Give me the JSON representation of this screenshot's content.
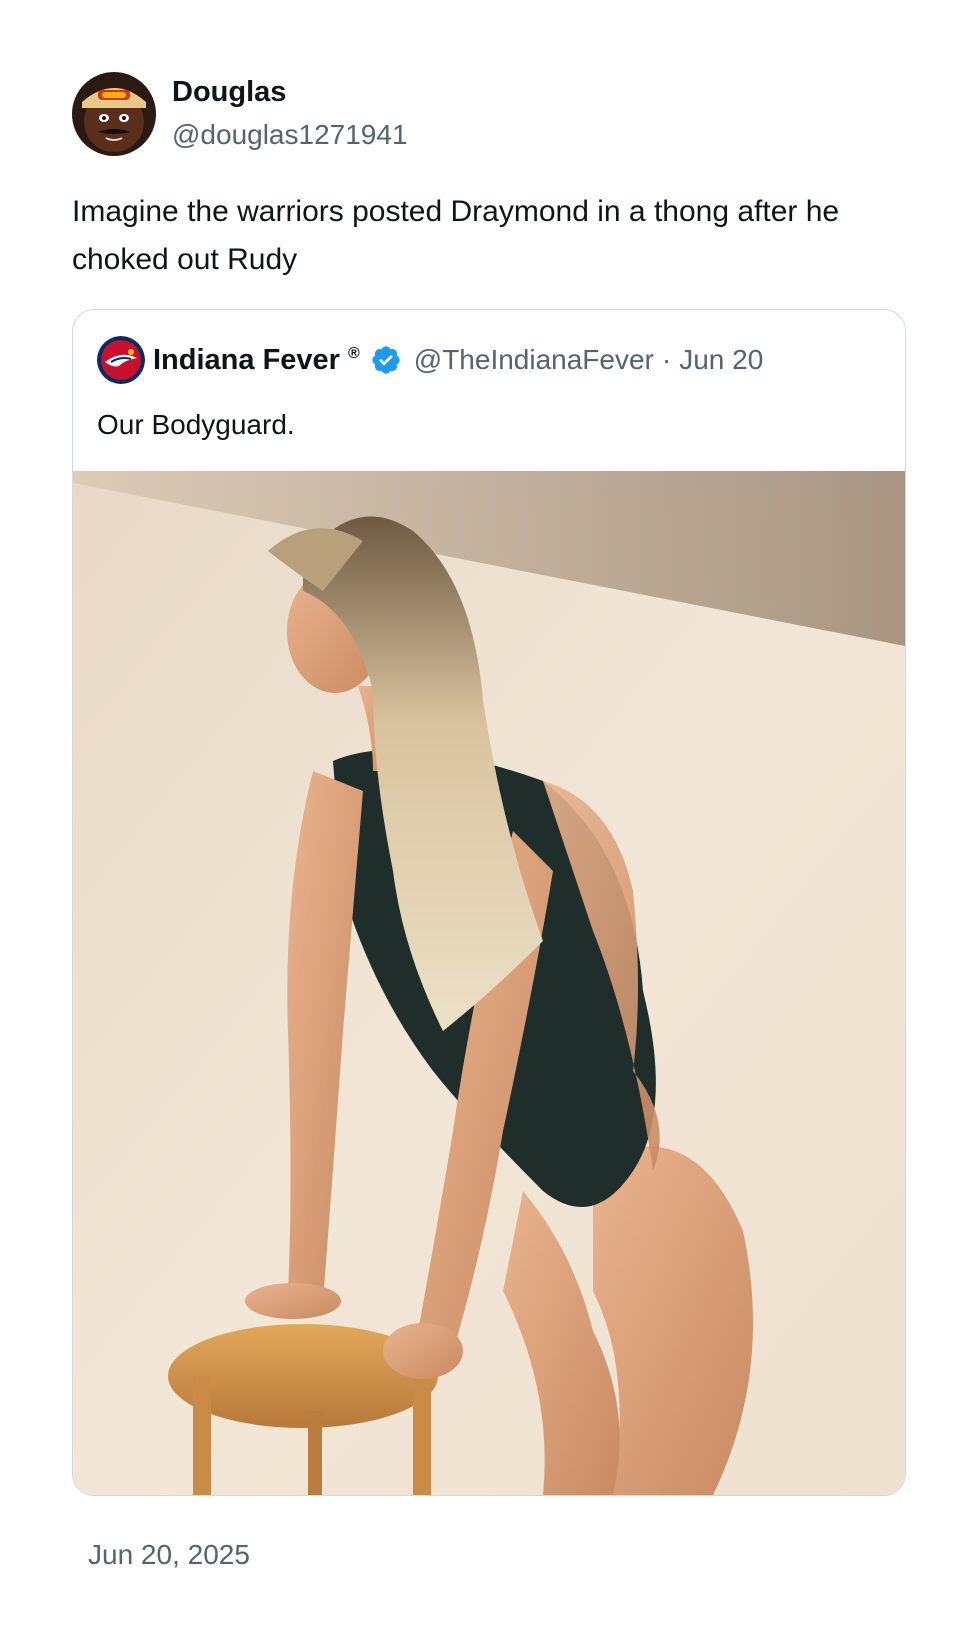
{
  "author": {
    "name": "Douglas",
    "handle": "@douglas1271941",
    "avatar_icon": "user-avatar"
  },
  "tweet": {
    "text": "Imagine the warriors posted Draymond in a thong after he choked out Rudy",
    "timestamp": "Jun 20, 2025"
  },
  "quoted_tweet": {
    "author_name": "Indiana Fever",
    "registered_mark": "®",
    "verified_icon": "verified-badge-icon",
    "handle": "@TheIndianaFever",
    "separator": "·",
    "date": "Jun 20",
    "text": "Our Bodyguard.",
    "media_icon": "photo-media"
  },
  "colors": {
    "text_primary": "#0f1419",
    "text_secondary": "#536471",
    "border": "#cfd9de",
    "verified_blue": "#1d9bf0",
    "fever_red": "#c8102e",
    "fever_navy": "#002d62"
  }
}
